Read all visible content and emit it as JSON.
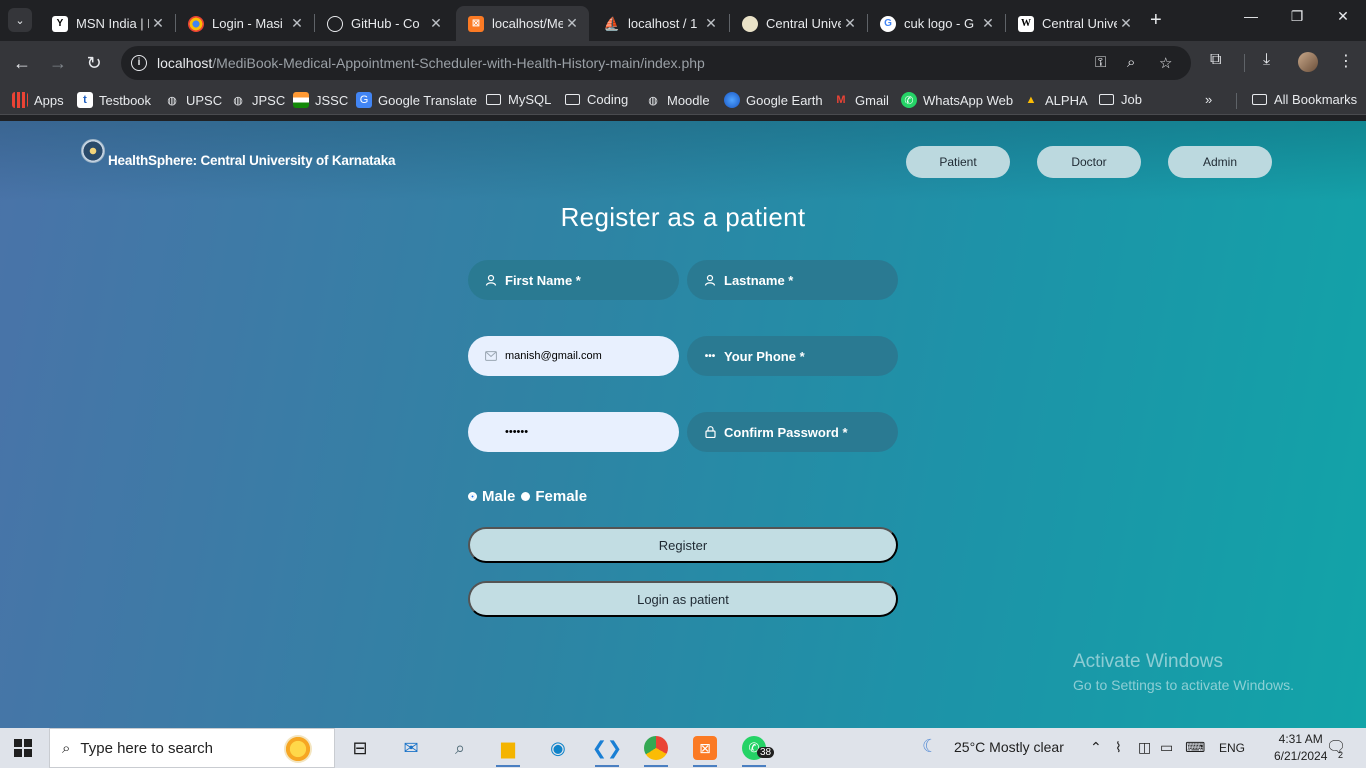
{
  "browser": {
    "tabs": [
      {
        "title": "MSN India | N",
        "favicon": "msn-icon",
        "color": "#202124",
        "active": false
      },
      {
        "title": "Login - Masi",
        "favicon": "chrome-icon",
        "color": "#202124",
        "active": false
      },
      {
        "title": "GitHub - Co",
        "favicon": "github-icon",
        "color": "#202124",
        "active": false
      },
      {
        "title": "localhost/Me",
        "favicon": "xampp-icon",
        "color": "#35363a",
        "active": true
      },
      {
        "title": "localhost / 1",
        "favicon": "phpmyadmin-icon",
        "color": "#202124",
        "active": false
      },
      {
        "title": "Central Unive",
        "favicon": "cuk-icon",
        "color": "#202124",
        "active": false
      },
      {
        "title": "cuk logo - G",
        "favicon": "google-icon",
        "color": "#202124",
        "active": false
      },
      {
        "title": "Central Unive",
        "favicon": "wikipedia-icon",
        "color": "#202124",
        "active": false
      }
    ],
    "url_host": "localhost",
    "url_path": "/MediBook-Medical-Appointment-Scheduler-with-Health-History-main/index.php",
    "bookmarks": [
      {
        "label": "Apps",
        "icon": "apps-grid-icon"
      },
      {
        "label": "Testbook",
        "icon": "testbook-icon"
      },
      {
        "label": "UPSC",
        "icon": "globe-icon"
      },
      {
        "label": "JPSC",
        "icon": "globe-icon"
      },
      {
        "label": "JSSC",
        "icon": "india-flag-icon"
      },
      {
        "label": "Google Translate",
        "icon": "translate-icon"
      },
      {
        "label": "MySQL",
        "icon": "folder-icon"
      },
      {
        "label": "Coding",
        "icon": "folder-icon"
      },
      {
        "label": "Moodle",
        "icon": "globe-icon"
      },
      {
        "label": "Google Earth",
        "icon": "earth-icon"
      },
      {
        "label": "Gmail",
        "icon": "gmail-icon"
      },
      {
        "label": "WhatsApp Web",
        "icon": "whatsapp-icon"
      },
      {
        "label": "ALPHA",
        "icon": "drive-icon"
      },
      {
        "label": "Job",
        "icon": "folder-icon"
      }
    ],
    "all_bookmarks": "All Bookmarks"
  },
  "page": {
    "brand": "HealthSphere: Central University of Karnataka",
    "nav": {
      "patient": "Patient",
      "doctor": "Doctor",
      "admin": "Admin"
    },
    "heading": "Register as a patient",
    "fields": {
      "first_name": "First Name *",
      "last_name": "Lastname *",
      "email": "manish@gmail.com",
      "phone": "Your Phone *",
      "password": "••••••",
      "confirm_password": "Confirm Password *"
    },
    "gender": {
      "male": "Male",
      "female": "Female",
      "selected": "male"
    },
    "register_btn": "Register",
    "login_btn": "Login as patient",
    "watermark_title": "Activate Windows",
    "watermark_sub": "Go to Settings to activate Windows.",
    "colors": {
      "field_bg": "#2a7a92",
      "button_bg": "#c2dde3",
      "filled_bg": "#e8f0fe"
    }
  },
  "taskbar": {
    "search_placeholder": "Type here to search",
    "weather": "25°C  Mostly clear",
    "lang": "ENG",
    "time": "4:31 AM",
    "date": "6/21/2024",
    "whatsapp_badge": "38",
    "notif_count": "2"
  }
}
